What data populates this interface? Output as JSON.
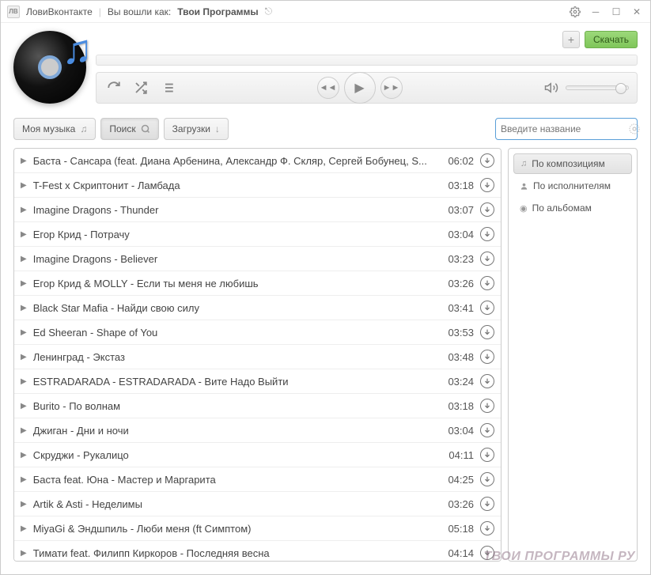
{
  "titlebar": {
    "app_name": "ЛовиВконтакте",
    "login_prefix": "Вы вошли как:",
    "login_name": "Твои Программы"
  },
  "header": {
    "add_label": "+",
    "download_label": "Скачать"
  },
  "tabs": {
    "my_music": "Моя музыка",
    "search": "Поиск",
    "downloads": "Загрузки"
  },
  "search": {
    "placeholder": "Введите название"
  },
  "filters": {
    "by_tracks": "По композициям",
    "by_artists": "По исполнителям",
    "by_albums": "По альбомам"
  },
  "tracks": [
    {
      "title": "Баста - Сансара (feat. Диана Арбенина, Александр Ф. Скляр, Сергей Бобунец, S...",
      "duration": "06:02"
    },
    {
      "title": "T-Fest x Скриптонит - Ламбада",
      "duration": "03:18"
    },
    {
      "title": "Imagine Dragons - Thunder",
      "duration": "03:07"
    },
    {
      "title": "Егор Крид - Потрачу",
      "duration": "03:04"
    },
    {
      "title": "Imagine Dragons - Believer",
      "duration": "03:23"
    },
    {
      "title": "Егор Крид & MOLLY - Если ты меня не любишь",
      "duration": "03:26"
    },
    {
      "title": "Black Star Mafia - Найди свою силу",
      "duration": "03:41"
    },
    {
      "title": "Ed Sheeran - Shape of You",
      "duration": "03:53"
    },
    {
      "title": "Ленинград - Экстаз",
      "duration": "03:48"
    },
    {
      "title": "ESTRADARADA - ESTRADARADA - Вите Надо Выйти",
      "duration": "03:24"
    },
    {
      "title": "Burito - По волнам",
      "duration": "03:18"
    },
    {
      "title": "Джиган - Дни и ночи",
      "duration": "03:04"
    },
    {
      "title": "Скруджи - Рукалицо",
      "duration": "04:11"
    },
    {
      "title": "Баста feat. Юна - Мастер и Маргарита",
      "duration": "04:25"
    },
    {
      "title": "Artik & Asti - Неделимы",
      "duration": "03:26"
    },
    {
      "title": "MiyaGi & Эндшпиль - Люби меня (ft Симптом)",
      "duration": "05:18"
    },
    {
      "title": "Тимати feat. Филипп Киркоров - Последняя весна",
      "duration": "04:14"
    }
  ],
  "watermark": "ТВОИ ПРОГРАММЫ РУ"
}
